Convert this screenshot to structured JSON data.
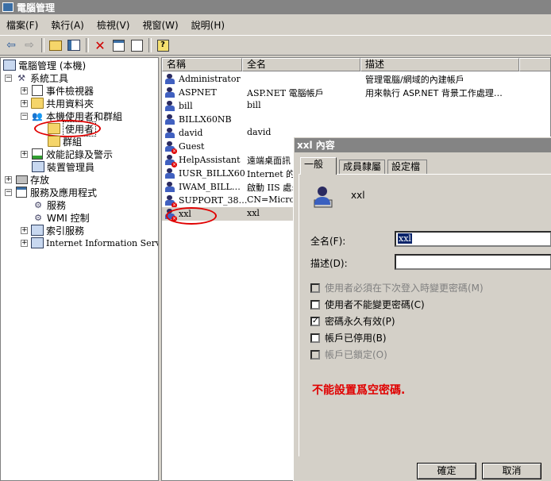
{
  "window": {
    "title": "電腦管理"
  },
  "menu": [
    "檔案(F)",
    "執行(A)",
    "檢視(V)",
    "視窗(W)",
    "說明(H)"
  ],
  "toolbar_icons": [
    "back-icon",
    "forward-icon",
    "up-folder-icon",
    "show-hide-tree-icon",
    "delete-icon",
    "properties-icon",
    "export-icon",
    "help-icon"
  ],
  "tree": {
    "root": "電腦管理 (本機)",
    "system_tools": "系統工具",
    "event_viewer": "事件檢視器",
    "shared_folders": "共用資料夾",
    "local_users": "本機使用者和群組",
    "users": "使用者",
    "groups": "群組",
    "perf_logs": "效能記錄及警示",
    "device_manager": "裝置管理員",
    "storage": "存放",
    "services_apps": "服務及應用程式",
    "services": "服務",
    "wmi": "WMI 控制",
    "indexing": "索引服務",
    "iis": "Internet Information Services"
  },
  "list": {
    "headers": [
      "名稱",
      "全名",
      "描述"
    ],
    "rows": [
      {
        "name": "Administrator",
        "full": "",
        "desc": "管理電腦/網域的內建帳戶",
        "disabled": false
      },
      {
        "name": "ASPNET",
        "full": "ASP.NET 電腦帳戶",
        "desc": "用來執行 ASP.NET 背景工作處理…",
        "disabled": false
      },
      {
        "name": "bill",
        "full": "bill",
        "desc": "",
        "disabled": false
      },
      {
        "name": "BILLX60NB",
        "full": "",
        "desc": "",
        "disabled": false
      },
      {
        "name": "david",
        "full": "david",
        "desc": "",
        "disabled": false
      },
      {
        "name": "Guest",
        "full": "",
        "desc": "",
        "disabled": true
      },
      {
        "name": "HelpAssistant",
        "full": "遠端桌面訊",
        "desc": "",
        "disabled": true
      },
      {
        "name": "IUSR_BILLX60",
        "full": "Internet 的 (",
        "desc": "",
        "disabled": false
      },
      {
        "name": "IWAM_BILL…",
        "full": "啟動 IIS 處:",
        "desc": "",
        "disabled": false
      },
      {
        "name": "SUPPORT_38…",
        "full": "CN=Microsc",
        "desc": "",
        "disabled": true
      },
      {
        "name": "xxl",
        "full": "xxl",
        "desc": "",
        "disabled": true
      }
    ]
  },
  "dialog": {
    "title": "xxl 內容",
    "tabs": [
      "一般",
      "成員隸屬",
      "設定檔"
    ],
    "username": "xxl",
    "fullname_label": "全名(F):",
    "fullname_value": "xxl",
    "desc_label": "描述(D):",
    "desc_value": "",
    "checkboxes": [
      {
        "label": "使用者必須在下次登入時變更密碼(M)",
        "checked": false,
        "disabled": true
      },
      {
        "label": "使用者不能變更密碼(C)",
        "checked": false,
        "disabled": false
      },
      {
        "label": "密碼永久有效(P)",
        "checked": true,
        "disabled": false
      },
      {
        "label": "帳戶已停用(B)",
        "checked": false,
        "disabled": false
      },
      {
        "label": "帳戶已鎖定(O)",
        "checked": false,
        "disabled": true
      }
    ],
    "note": "不能設置爲空密碼.",
    "ok": "確定",
    "cancel": "取消"
  }
}
